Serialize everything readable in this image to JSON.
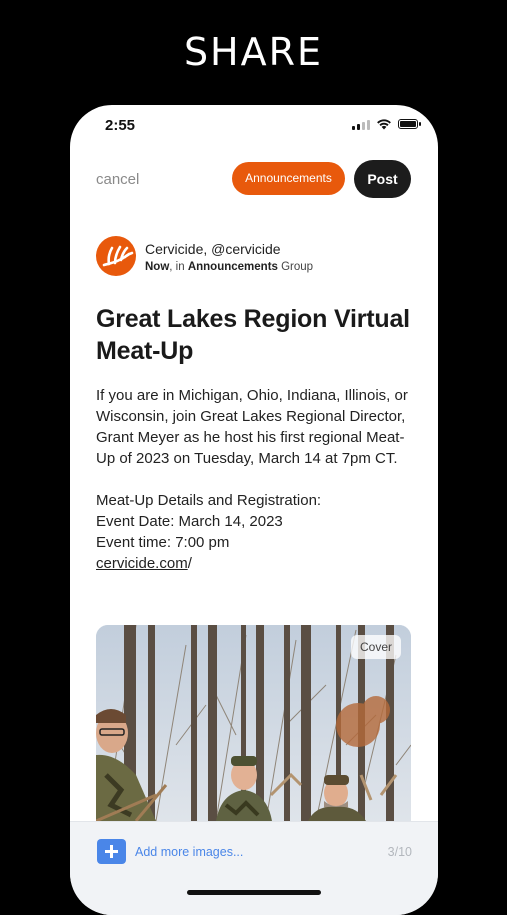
{
  "headline": "SHARE",
  "status_bar": {
    "time": "2:55"
  },
  "composer": {
    "cancel_label": "cancel",
    "group_label": "Announcements",
    "post_label": "Post",
    "accent_color": "#e8590c"
  },
  "author": {
    "name": "Cervicide, @cervicide",
    "time": "Now",
    "meta_in": ", in ",
    "group": "Announcements",
    "meta_suffix": " Group"
  },
  "post": {
    "title": "Great Lakes Region Virtual Meat-Up",
    "intro": "If you are in Michigan, Ohio, Indiana, Illinois, or Wisconsin, join Great Lakes Regional Director, Grant Meyer as he host his first regional Meat-Up of 2023 on Tuesday, March 14 at 7pm CT.",
    "details_heading": "Meat-Up Details and Registration:",
    "event_date": "Event Date: March 14, 2023",
    "event_time": "Event time: 7:00 pm",
    "link_text": "cervicide.com",
    "link_suffix": "/"
  },
  "image": {
    "cover_label": "Cover"
  },
  "bottom_bar": {
    "add_label": "Add more images...",
    "count": "3/10",
    "link_color": "#4a86e8"
  }
}
